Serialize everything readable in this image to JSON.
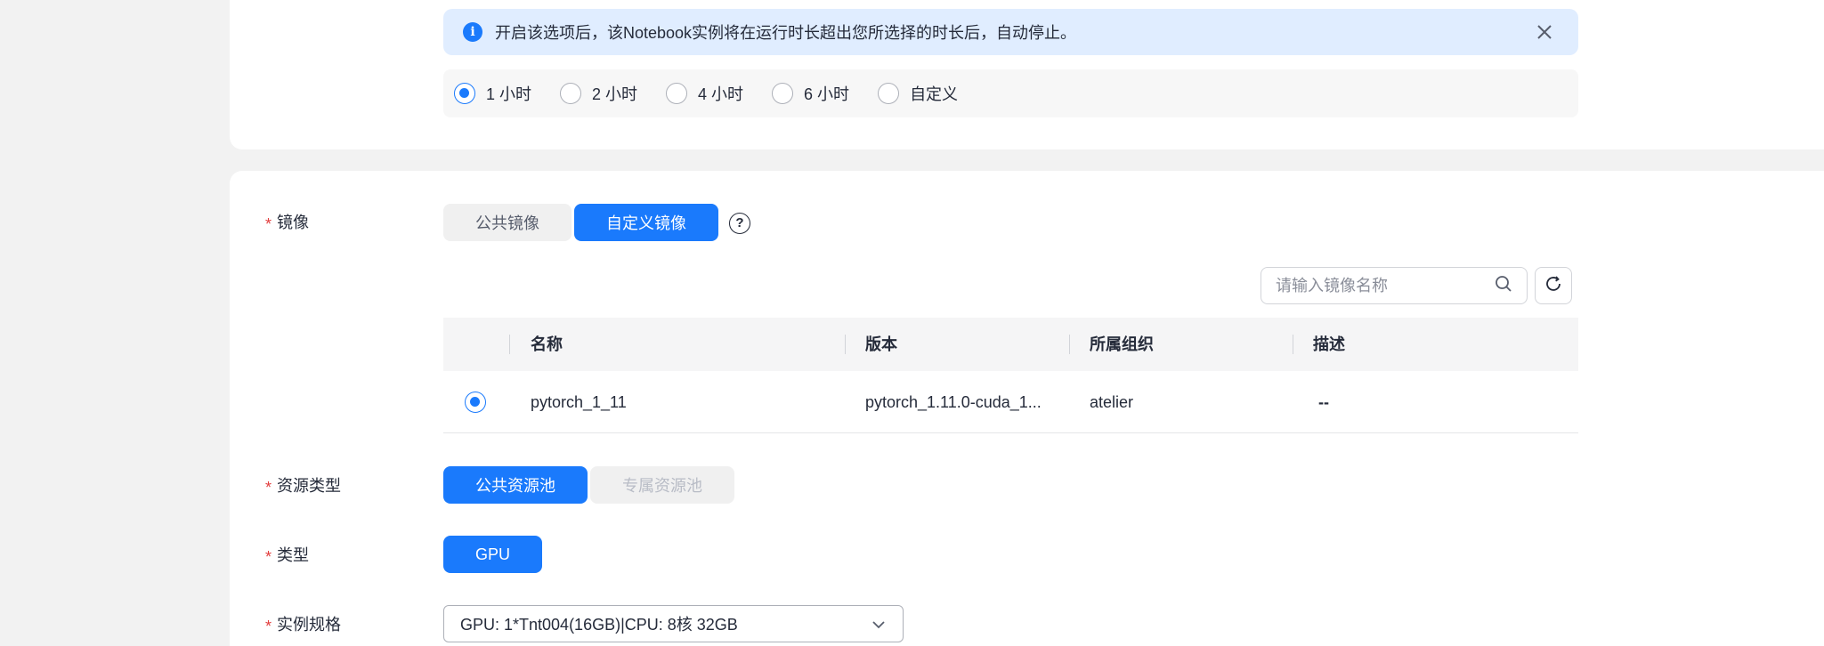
{
  "auto_stop": {
    "alert_message": "开启该选项后，该Notebook实例将在运行时长超出您所选择的时长后，自动停止。",
    "options": [
      {
        "label": "1 小时",
        "checked": true
      },
      {
        "label": "2 小时",
        "checked": false
      },
      {
        "label": "4 小时",
        "checked": false
      },
      {
        "label": "6 小时",
        "checked": false
      },
      {
        "label": "自定义",
        "checked": false
      }
    ]
  },
  "image": {
    "label": "镜像",
    "tabs": [
      {
        "label": "公共镜像",
        "active": false
      },
      {
        "label": "自定义镜像",
        "active": true
      }
    ],
    "search_placeholder": "请输入镜像名称",
    "table": {
      "columns": [
        "名称",
        "版本",
        "所属组织",
        "描述"
      ],
      "rows": [
        {
          "selected": true,
          "name": "pytorch_1_11",
          "version": "pytorch_1.11.0-cuda_1...",
          "org": "atelier",
          "desc": "--"
        }
      ]
    }
  },
  "resource_type": {
    "label": "资源类型",
    "options": [
      {
        "label": "公共资源池",
        "active": true
      },
      {
        "label": "专属资源池",
        "disabled": true
      }
    ]
  },
  "type": {
    "label": "类型",
    "options": [
      {
        "label": "GPU",
        "active": true
      }
    ]
  },
  "flavor": {
    "label": "实例规格",
    "value": "GPU: 1*Tnt004(16GB)|CPU: 8核 32GB"
  },
  "colors": {
    "primary": "#1a7afc",
    "alert_bg": "#e0edff",
    "required": "#e23e3e"
  },
  "icons": [
    "info-icon",
    "close-icon",
    "help-icon",
    "search-icon",
    "refresh-icon",
    "chevron-down-icon"
  ]
}
